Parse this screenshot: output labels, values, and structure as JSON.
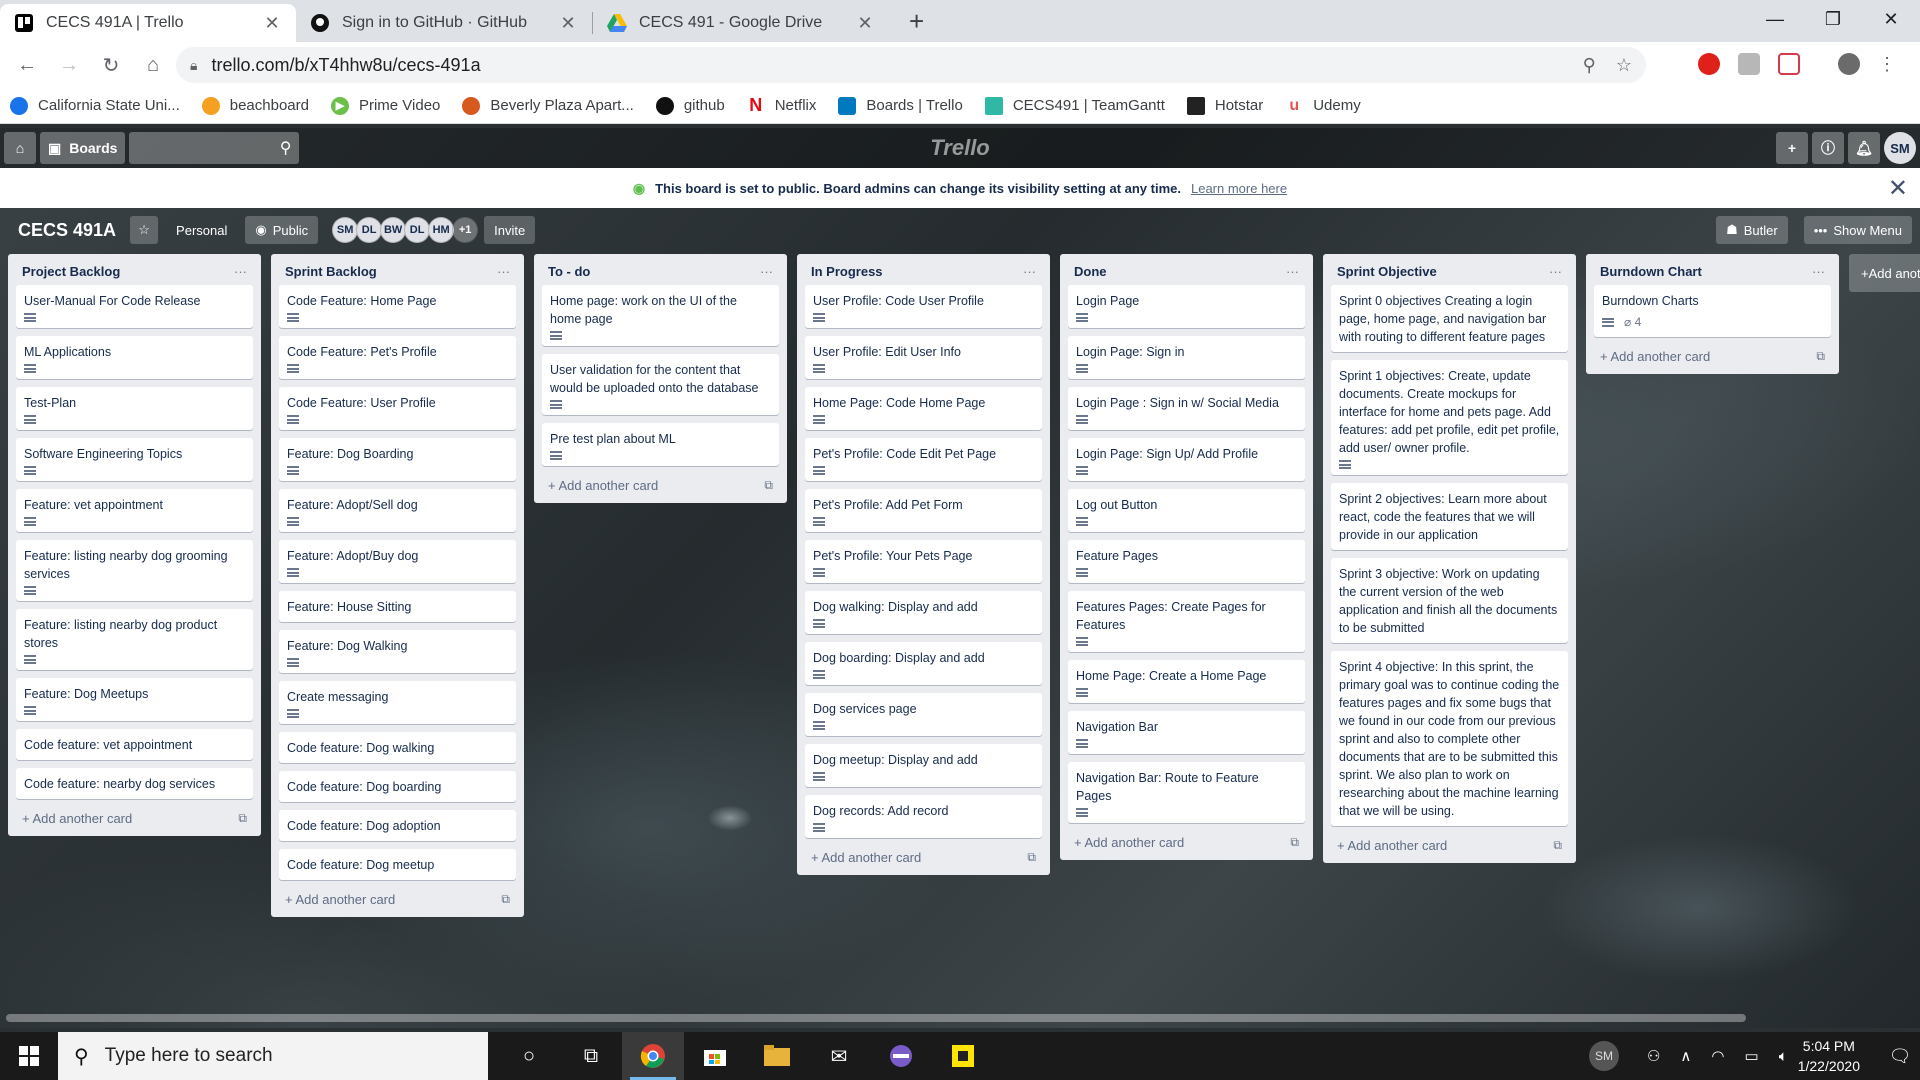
{
  "browser": {
    "tabs": [
      {
        "title": "CECS 491A | Trello",
        "icon": "trello-icon"
      },
      {
        "title": "Sign in to GitHub · GitHub",
        "icon": "github-icon"
      },
      {
        "title": "CECS 491 - Google Drive",
        "icon": "google-drive-icon"
      }
    ],
    "url": "trello.com/b/xT4hhw8u/cecs-491a",
    "bookmarks": [
      {
        "label": "California State Uni...",
        "icon": "csu-icon",
        "color": "#1a73e8"
      },
      {
        "label": "beachboard",
        "icon": "beachboard-icon",
        "color": "#f4a020"
      },
      {
        "label": "Prime Video",
        "icon": "prime-video-icon",
        "color": "#6cc04a"
      },
      {
        "label": "Beverly Plaza Apart...",
        "icon": "beverly-icon",
        "color": "#d65a1e"
      },
      {
        "label": "github",
        "icon": "github-icon",
        "color": "#111111"
      },
      {
        "label": "Netflix",
        "icon": "netflix-icon",
        "color": "#e50914"
      },
      {
        "label": "Boards | Trello",
        "icon": "trello-icon",
        "color": "#0079bf"
      },
      {
        "label": "CECS491 | TeamGantt",
        "icon": "teamgantt-icon",
        "color": "#2fb8a4"
      },
      {
        "label": "Hotstar",
        "icon": "hotstar-icon",
        "color": "#222222"
      },
      {
        "label": "Udemy",
        "icon": "udemy-icon",
        "color": "#ec5252"
      }
    ]
  },
  "trello_header": {
    "boards_label": "Boards",
    "logo": "Trello",
    "user_initials": "SM"
  },
  "banner": {
    "message": "This board is set to public. Board admins can change its visibility setting at any time.",
    "link": "Learn more here"
  },
  "board": {
    "title": "CECS 491A",
    "team": "Personal",
    "visibility": "Public",
    "members": [
      "SM",
      "DL",
      "BW",
      "DL",
      "HM"
    ],
    "members_more": "+1",
    "invite": "Invite",
    "butler": "Butler",
    "show_menu": "Show Menu",
    "add_list": "Add another list"
  },
  "lists": [
    {
      "title": "Project Backlog",
      "add_card": "Add another card",
      "cards": [
        {
          "text": "User-Manual For Code Release",
          "desc": true
        },
        {
          "text": "ML Applications",
          "desc": true
        },
        {
          "text": "Test-Plan",
          "desc": true
        },
        {
          "text": "Software Engineering Topics",
          "desc": true
        },
        {
          "text": "Feature: vet appointment",
          "desc": true
        },
        {
          "text": "Feature: listing nearby dog grooming services",
          "desc": true
        },
        {
          "text": "Feature: listing nearby dog product stores",
          "desc": true
        },
        {
          "text": "Feature: Dog Meetups",
          "desc": true
        },
        {
          "text": "Code feature: vet appointment",
          "desc": false
        },
        {
          "text": "Code feature: nearby dog services",
          "desc": false
        }
      ]
    },
    {
      "title": "Sprint Backlog",
      "add_card": "Add another card",
      "cards": [
        {
          "text": "Code Feature: Home Page",
          "desc": true
        },
        {
          "text": "Code Feature: Pet's Profile",
          "desc": true
        },
        {
          "text": "Code Feature: User Profile",
          "desc": true
        },
        {
          "text": "Feature: Dog Boarding",
          "desc": true
        },
        {
          "text": "Feature: Adopt/Sell dog",
          "desc": true
        },
        {
          "text": "Feature: Adopt/Buy dog",
          "desc": true
        },
        {
          "text": "Feature: House Sitting",
          "desc": false
        },
        {
          "text": "Feature: Dog Walking",
          "desc": true
        },
        {
          "text": "Create messaging",
          "desc": true
        },
        {
          "text": "Code feature: Dog walking",
          "desc": false
        },
        {
          "text": "Code feature: Dog boarding",
          "desc": false
        },
        {
          "text": "Code feature: Dog adoption",
          "desc": false
        },
        {
          "text": "Code feature: Dog meetup",
          "desc": false
        }
      ]
    },
    {
      "title": "To - do",
      "add_card": "Add another card",
      "cards": [
        {
          "text": "Home page: work on the UI of the home page",
          "desc": true
        },
        {
          "text": "User validation for the content that would be uploaded onto the database",
          "desc": true
        },
        {
          "text": "Pre test plan about ML",
          "desc": true
        }
      ]
    },
    {
      "title": "In Progress",
      "add_card": "Add another card",
      "cards": [
        {
          "text": "User Profile: Code User Profile",
          "desc": true
        },
        {
          "text": "User Profile: Edit User Info",
          "desc": true
        },
        {
          "text": "Home Page: Code Home Page",
          "desc": true
        },
        {
          "text": "Pet's Profile: Code Edit Pet Page",
          "desc": true
        },
        {
          "text": "Pet's Profile: Add Pet Form",
          "desc": true
        },
        {
          "text": "Pet's Profile: Your Pets Page",
          "desc": true
        },
        {
          "text": "Dog walking: Display and add",
          "desc": true
        },
        {
          "text": "Dog boarding: Display and add",
          "desc": true
        },
        {
          "text": "Dog services page",
          "desc": true
        },
        {
          "text": "Dog meetup: Display and add",
          "desc": true
        },
        {
          "text": "Dog records: Add record",
          "desc": true
        }
      ]
    },
    {
      "title": "Done",
      "add_card": "Add another card",
      "cards": [
        {
          "text": "Login Page",
          "desc": true
        },
        {
          "text": "Login Page: Sign in",
          "desc": true
        },
        {
          "text": "Login Page : Sign in w/ Social Media",
          "desc": true
        },
        {
          "text": "Login Page: Sign Up/ Add Profile",
          "desc": true
        },
        {
          "text": "Log out Button",
          "desc": true
        },
        {
          "text": "Feature Pages",
          "desc": true
        },
        {
          "text": "Features Pages: Create Pages for Features",
          "desc": true
        },
        {
          "text": "Home Page: Create a Home Page",
          "desc": true
        },
        {
          "text": "Navigation Bar",
          "desc": true
        },
        {
          "text": "Navigation Bar: Route to Feature Pages",
          "desc": true
        }
      ]
    },
    {
      "title": "Sprint Objective",
      "add_card": "Add another card",
      "cards": [
        {
          "text": "Sprint 0 objectives Creating a login page, home page, and navigation bar with routing to different feature pages",
          "desc": false
        },
        {
          "text": "Sprint 1 objectives: Create, update documents. Create mockups for interface for home and pets page. Add features: add pet profile, edit pet profile, add user/ owner profile.",
          "desc": true
        },
        {
          "text": "Sprint 2 objectives: Learn more about react, code the features that we will provide in our application",
          "desc": false
        },
        {
          "text": "Sprint 3 objective: Work on updating the current version of the web application and finish all the documents to be submitted",
          "desc": false
        },
        {
          "text": "Sprint 4 objective: In this sprint, the primary goal was to continue coding the features pages and fix some bugs that we found in our code from our previous sprint and also to complete other documents that are to be submitted this sprint. We also plan to work on researching about the machine learning that we will be using.",
          "desc": false
        }
      ]
    },
    {
      "title": "Burndown Chart",
      "add_card": "Add another card",
      "cards": [
        {
          "text": "Burndown Charts",
          "desc": true,
          "attachments": "4"
        }
      ]
    }
  ],
  "taskbar": {
    "search_placeholder": "Type here to search",
    "user_initials": "SM",
    "time": "5:04 PM",
    "date": "1/22/2020"
  }
}
